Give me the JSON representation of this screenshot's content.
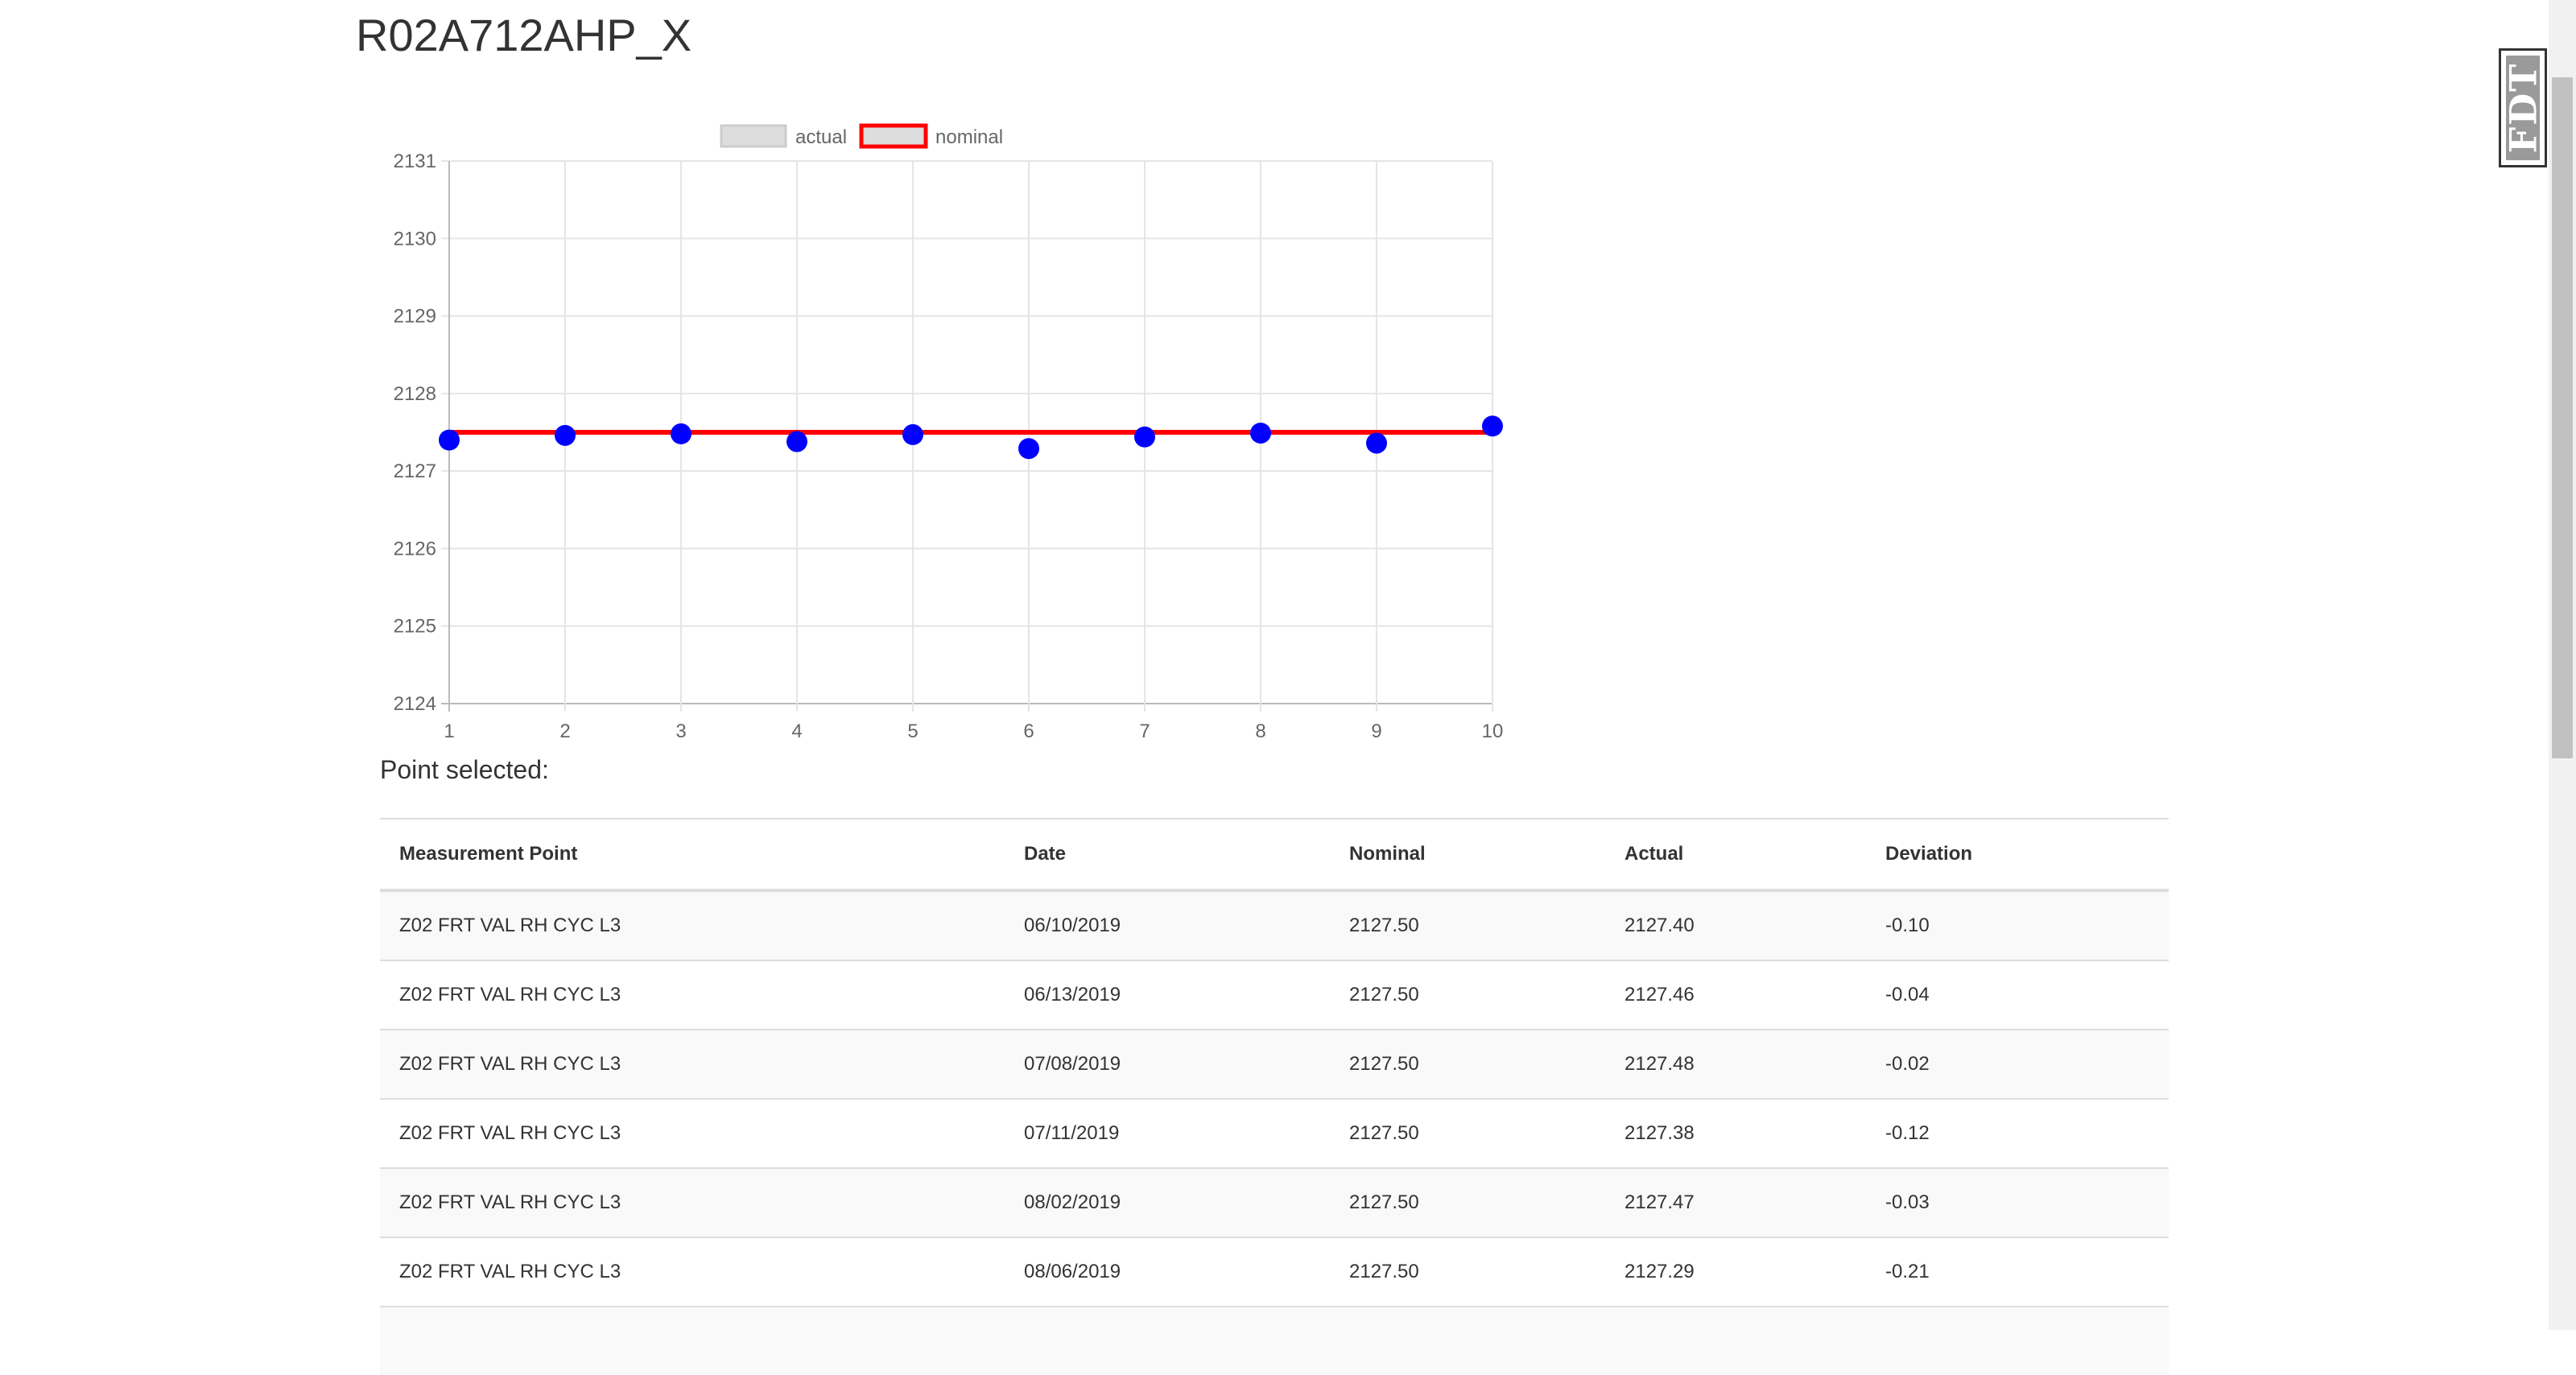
{
  "page": {
    "title": "R02A712AHP_X"
  },
  "chart_data": {
    "type": "line",
    "x": [
      1,
      2,
      3,
      4,
      5,
      6,
      7,
      8,
      9,
      10
    ],
    "series": [
      {
        "name": "actual",
        "values": [
          2127.4,
          2127.46,
          2127.48,
          2127.38,
          2127.47,
          2127.29,
          2127.44,
          2127.49,
          2127.36,
          2127.58
        ],
        "color": "#0000ff",
        "legend_fill": "#dddddd",
        "show_line": false
      },
      {
        "name": "nominal",
        "values": [
          2127.5,
          2127.5,
          2127.5,
          2127.5,
          2127.5,
          2127.5,
          2127.5,
          2127.5,
          2127.5,
          2127.5
        ],
        "color": "#ff0000",
        "legend_fill": "#dddddd",
        "show_line": true
      }
    ],
    "xlim": [
      1,
      10
    ],
    "ylim": [
      2124,
      2131
    ],
    "x_ticks": [
      "1",
      "2",
      "3",
      "4",
      "5",
      "6",
      "7",
      "8",
      "9",
      "10"
    ],
    "y_ticks": [
      "2124",
      "2125",
      "2126",
      "2127",
      "2128",
      "2129",
      "2130",
      "2131"
    ],
    "grid": true,
    "legend_position": "top",
    "title": "",
    "xlabel": "",
    "ylabel": ""
  },
  "selection": {
    "label": "Point selected:"
  },
  "table": {
    "headers": [
      "Measurement Point",
      "Date",
      "Nominal",
      "Actual",
      "Deviation"
    ],
    "rows": [
      [
        "Z02 FRT VAL RH CYC L3",
        "06/10/2019",
        "2127.50",
        "2127.40",
        "-0.10"
      ],
      [
        "Z02 FRT VAL RH CYC L3",
        "06/13/2019",
        "2127.50",
        "2127.46",
        "-0.04"
      ],
      [
        "Z02 FRT VAL RH CYC L3",
        "07/08/2019",
        "2127.50",
        "2127.48",
        "-0.02"
      ],
      [
        "Z02 FRT VAL RH CYC L3",
        "07/11/2019",
        "2127.50",
        "2127.38",
        "-0.12"
      ],
      [
        "Z02 FRT VAL RH CYC L3",
        "08/02/2019",
        "2127.50",
        "2127.47",
        "-0.03"
      ],
      [
        "Z02 FRT VAL RH CYC L3",
        "08/06/2019",
        "2127.50",
        "2127.29",
        "-0.21"
      ]
    ]
  },
  "badge": {
    "text": "FDT"
  },
  "icons": {
    "badge": "fdt-logo-icon"
  }
}
